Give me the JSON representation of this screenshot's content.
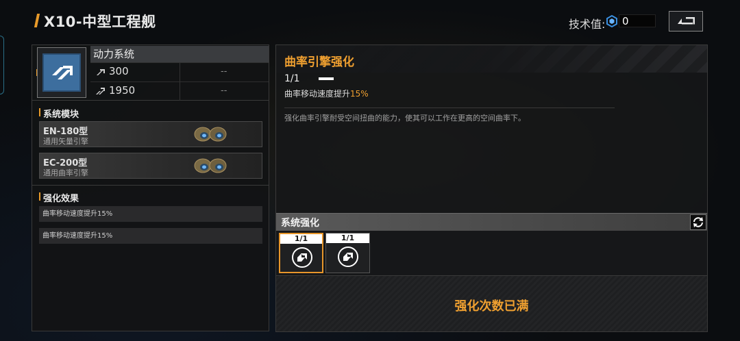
{
  "header": {
    "title": "X10-中型工程舰",
    "tech_label": "技术值:",
    "tech_value": "0"
  },
  "system": {
    "name": "动力系统",
    "stats": [
      {
        "icon": "speed-icon",
        "value": "300",
        "next": "--"
      },
      {
        "icon": "acceleration-icon",
        "value": "1950",
        "next": "--"
      }
    ]
  },
  "modules": {
    "label": "系统模块",
    "items": [
      {
        "name": "EN-180型",
        "sub": "通用矢量引擎"
      },
      {
        "name": "EC-200型",
        "sub": "通用曲率引擎"
      }
    ]
  },
  "effects": {
    "label": "强化效果",
    "items": [
      "曲率移动速度提升15%",
      "曲率移动速度提升15%"
    ]
  },
  "upgrade": {
    "title": "曲率引擎强化",
    "level": "1/1",
    "effect_prefix": "曲率移动速度提升",
    "effect_value": "15%",
    "description": "强化曲率引擎耐受空间扭曲的能力，使其可以工作在更高的空间曲率下。"
  },
  "enhance": {
    "title": "系统强化",
    "slots": [
      {
        "count": "1/1",
        "selected": true
      },
      {
        "count": "1/1",
        "selected": false
      }
    ],
    "maxed_text": "强化次数已满"
  },
  "colors": {
    "accent": "#f0a030",
    "system_icon": "#3d6e9e"
  }
}
